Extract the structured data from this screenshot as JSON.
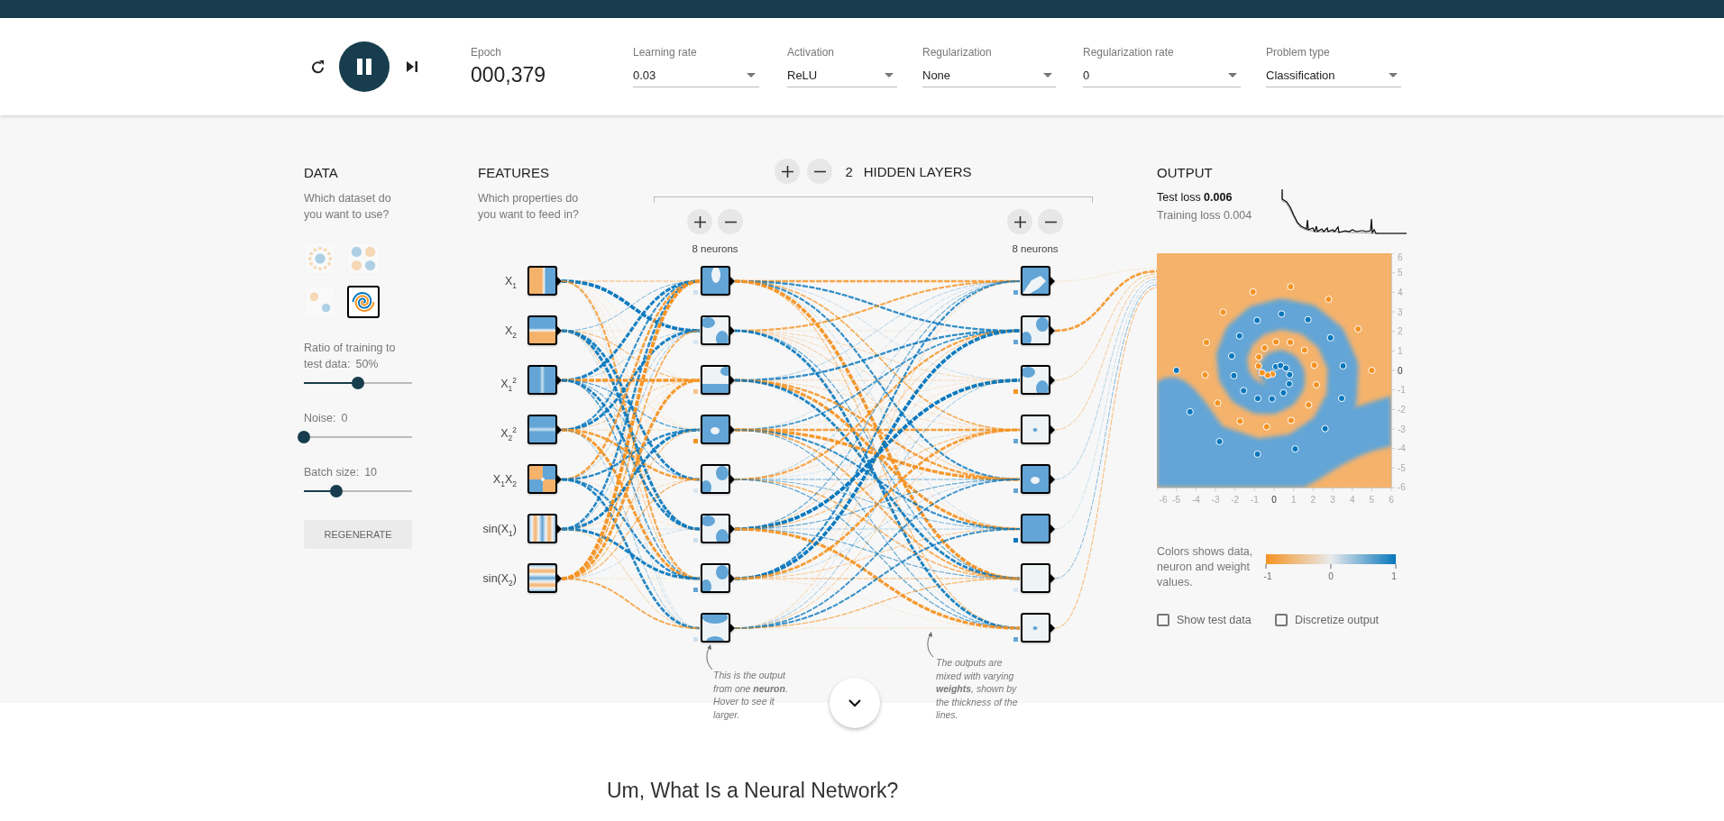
{
  "header": {
    "playing": true,
    "epoch": {
      "label": "Epoch",
      "value": "000,379"
    },
    "dropdowns": [
      {
        "label": "Learning rate",
        "value": "0.03"
      },
      {
        "label": "Activation",
        "value": "ReLU"
      },
      {
        "label": "Regularization",
        "value": "None"
      },
      {
        "label": "Regularization rate",
        "value": "0"
      },
      {
        "label": "Problem type",
        "value": "Classification"
      }
    ]
  },
  "data": {
    "title": "DATA",
    "subtitle": "Which dataset do you want to use?",
    "datasets": [
      {
        "kind": "circle",
        "selected": false
      },
      {
        "kind": "xor",
        "selected": false
      },
      {
        "kind": "gaussian",
        "selected": false
      },
      {
        "kind": "spiral",
        "selected": true
      }
    ],
    "sliders": [
      {
        "label": "Ratio of training to test data:",
        "value": "50%",
        "level": 0.5
      },
      {
        "label": "Noise:",
        "value": "0",
        "level": 0
      },
      {
        "label": "Batch size:",
        "value": "10",
        "level": 0.3
      }
    ],
    "regenerate": "REGENERATE"
  },
  "features": {
    "title": "FEATURES",
    "subtitle": "Which properties do you want to feed in?",
    "items": [
      {
        "label": "X$_{1}$",
        "kind": "x1"
      },
      {
        "label": "X$_{2}$",
        "kind": "x2"
      },
      {
        "label": "X$_{1}$$^{2}$",
        "kind": "x1sq"
      },
      {
        "label": "X$_{2}$$^{2}$",
        "kind": "x2sq"
      },
      {
        "label": "X$_{1}$X$_{2}$",
        "kind": "x1x2"
      },
      {
        "label": "sin(X$_{1}$)",
        "kind": "sin1"
      },
      {
        "label": "sin(X$_{2}$)",
        "kind": "sin2"
      }
    ]
  },
  "hidden_layers": {
    "count": "2",
    "label": "HIDDEN LAYERS",
    "layers": [
      {
        "neurons": "8 neurons"
      },
      {
        "neurons": "8 neurons"
      }
    ]
  },
  "annotations": [
    "This is the output from one **neuron**. Hover to see it larger.",
    "The outputs are mixed with varying **weights**, shown by the thickness of the lines."
  ],
  "output": {
    "title": "OUTPUT",
    "test_loss": {
      "label": "Test loss",
      "value": "0.006"
    },
    "training_loss": {
      "label": "Training loss",
      "value": "0.004"
    },
    "chart_data": {
      "type": "scatter",
      "xlim": [
        -6,
        6
      ],
      "ylim": [
        -6,
        6
      ],
      "xticks": [
        -6,
        -5,
        -4,
        -3,
        -2,
        -1,
        0,
        1,
        2,
        3,
        4,
        5,
        6
      ],
      "yticks": [
        -6,
        -5,
        -4,
        -3,
        -2,
        -1,
        0,
        1,
        2,
        3,
        4,
        5,
        6
      ],
      "series": [
        {
          "color": "#0877bd",
          "x": [
            0.09,
            0.33,
            0.61,
            0.8,
            0.78,
            0.48,
            -0.1,
            -0.83,
            -1.56,
            -2.06,
            -2.17,
            -1.77,
            -0.87,
            0.38,
            1.74,
            2.89,
            3.53,
            3.46,
            2.61,
            1.08,
            -0.85,
            -2.79,
            -4.3,
            -5.0
          ],
          "values": [
            0.19,
            0.25,
            0.12,
            -0.22,
            -0.69,
            -1.15,
            -1.46,
            -1.44,
            -1.04,
            -0.27,
            0.74,
            1.77,
            2.56,
            2.89,
            2.6,
            1.67,
            0.23,
            -1.43,
            -2.98,
            -4.02,
            -4.29,
            -3.64,
            -2.12,
            0.0
          ]
        },
        {
          "color": "#f59322",
          "x": [
            -0.09,
            -0.33,
            -0.61,
            -0.8,
            -0.78,
            -0.48,
            0.1,
            0.83,
            1.56,
            2.06,
            2.17,
            1.77,
            0.87,
            -0.38,
            -1.74,
            -2.89,
            -3.53,
            -3.46,
            -2.61,
            -1.08,
            0.85,
            2.79,
            4.3,
            5.0
          ],
          "values": [
            -0.19,
            -0.25,
            -0.12,
            0.22,
            0.69,
            1.15,
            1.46,
            1.44,
            1.04,
            0.27,
            -0.74,
            -1.77,
            -2.56,
            -2.89,
            -2.6,
            -1.67,
            -0.23,
            1.43,
            2.98,
            4.02,
            4.29,
            3.64,
            2.12,
            0.0
          ]
        }
      ]
    },
    "legend": {
      "text": "Colors shows data, neuron and weight values.",
      "ticks": [
        "-1",
        "0",
        "1"
      ]
    },
    "checkboxes": [
      {
        "label": "Show test data",
        "checked": false
      },
      {
        "label": "Discretize output",
        "checked": false
      }
    ]
  },
  "footer": {
    "heading": "Um, What Is a Neural Network?"
  }
}
